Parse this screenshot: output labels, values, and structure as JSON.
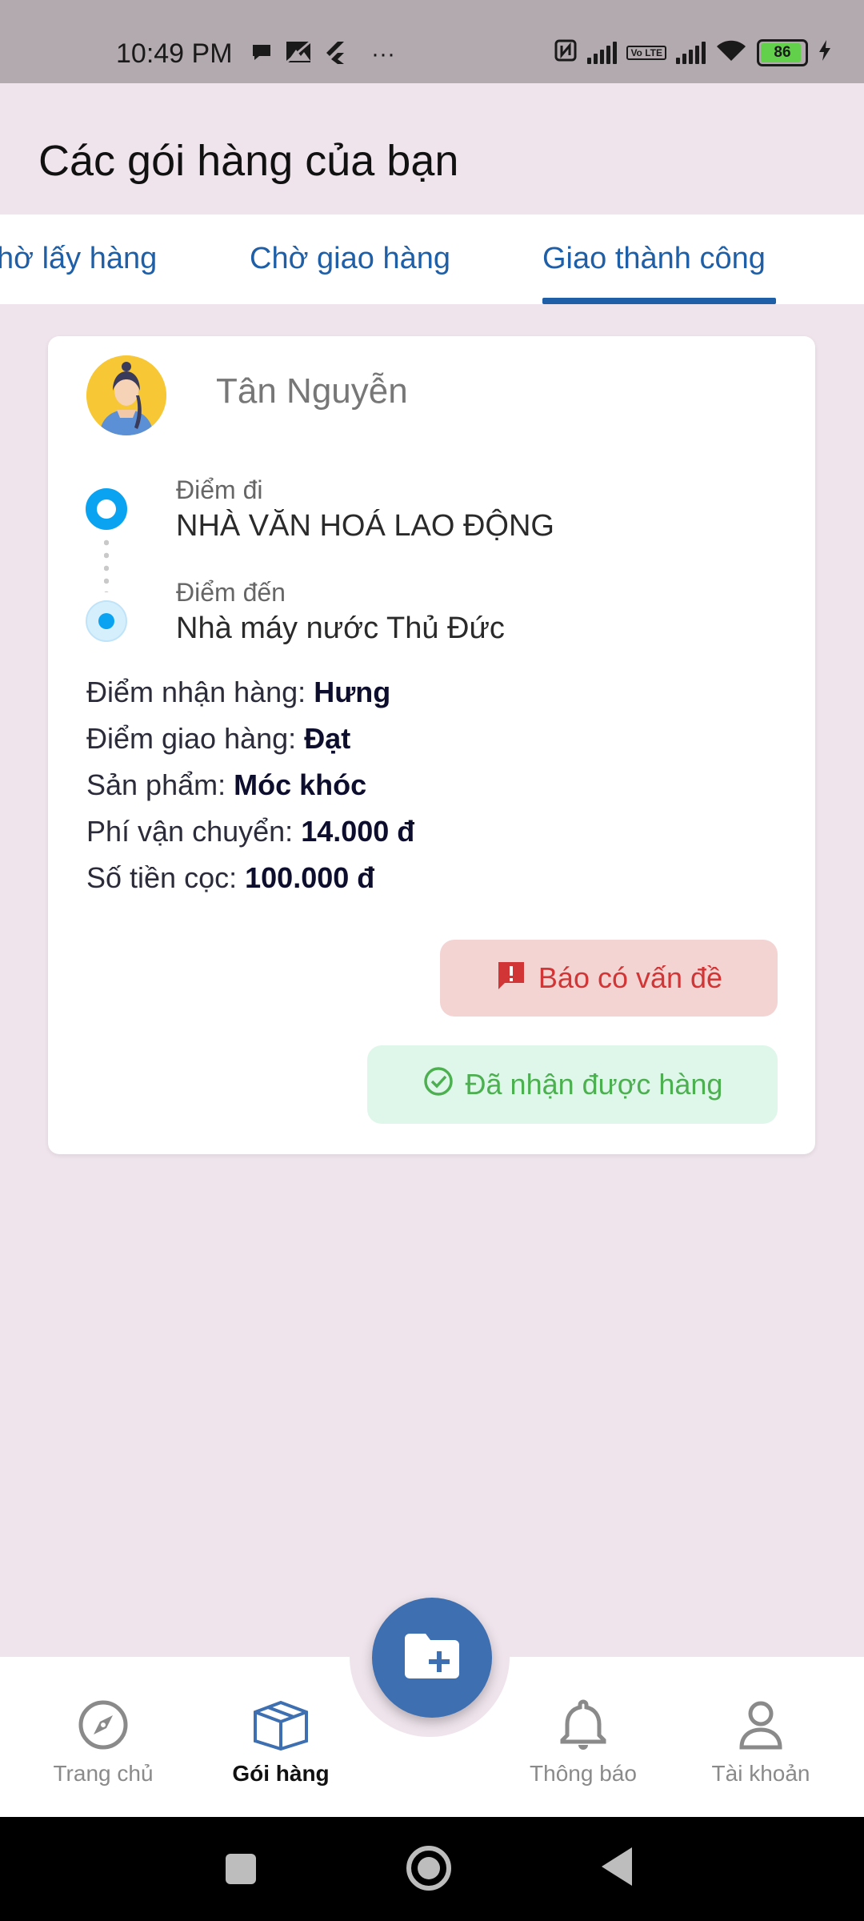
{
  "status_bar": {
    "time": "10:49 PM",
    "battery": "86",
    "volte": "Vo LTE",
    "icons": [
      "chat-bubble-icon",
      "image-icon",
      "flutter-icon",
      "more-icon",
      "nfc-icon",
      "signal-icon",
      "volte-icon",
      "signal-icon",
      "wifi-icon",
      "battery-icon",
      "charging-icon"
    ]
  },
  "header": {
    "title": "Các gói hàng của bạn"
  },
  "tabs": [
    {
      "label": "hờ lấy hàng"
    },
    {
      "label": "Chờ giao hàng"
    },
    {
      "label": "Giao thành công",
      "active": true
    }
  ],
  "card": {
    "user_name": "Tân Nguyễn",
    "origin_label": "Điểm đi",
    "origin_value": "NHÀ VĂN HOÁ LAO ĐỘNG",
    "destination_label": "Điểm đến",
    "destination_value": "Nhà máy nước Thủ Đức",
    "details": [
      {
        "label": "Điểm nhận hàng:",
        "value": "Hưng"
      },
      {
        "label": "Điểm giao hàng:",
        "value": "Đạt"
      },
      {
        "label": "Sản phẩm:",
        "value": "Móc khóc"
      },
      {
        "label": "Phí vận chuyển:",
        "value": "14.000 đ"
      },
      {
        "label": "Số tiền cọc:",
        "value": "100.000 đ"
      }
    ],
    "report_button": "Báo có vấn đề",
    "received_button": "Đã nhận được hàng"
  },
  "bottom_nav": {
    "items": [
      {
        "label": "Trang chủ",
        "icon": "compass-icon"
      },
      {
        "label": "Gói hàng",
        "icon": "package-icon",
        "active": true
      },
      {
        "label": "Thông báo",
        "icon": "bell-icon"
      },
      {
        "label": "Tài khoản",
        "icon": "person-icon"
      }
    ],
    "fab_icon": "folder-add-icon"
  },
  "colors": {
    "primary": "#1e5fa7",
    "fab": "#3e6fb0",
    "background": "#efe4ec",
    "danger": "#d13535",
    "success": "#4caf50",
    "route_dot": "#0aa3f2"
  }
}
